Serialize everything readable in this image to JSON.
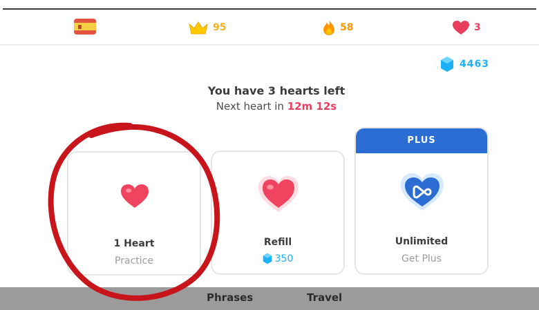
{
  "header": {
    "flag_icon": "spain-flag-icon",
    "crowns": {
      "icon": "crown-icon",
      "value": "95",
      "color": "#f2b01e"
    },
    "streak": {
      "icon": "flame-icon",
      "value": "58",
      "color": "#ff9600"
    },
    "hearts": {
      "icon": "heart-icon",
      "value": "3",
      "color": "#e83f5f"
    }
  },
  "gems": {
    "icon": "gem-icon",
    "value": "4463",
    "color": "#1cb0f6"
  },
  "message": {
    "title": "You have 3 hearts left",
    "next_prefix": "Next heart in",
    "timer": "12m 12s"
  },
  "cards": [
    {
      "title": "1 Heart",
      "subtitle": "Practice",
      "icon": "heart-icon"
    },
    {
      "title": "Refill",
      "price": "350",
      "icon": "heart-icon"
    },
    {
      "title": "Unlimited",
      "subtitle": "Get Plus",
      "badge": "PLUS",
      "icon": "infinity-heart-icon"
    }
  ],
  "bottom_tabs": [
    "Phrases",
    "Travel"
  ],
  "colors": {
    "plus_blue": "#2c6dd4",
    "heart_red": "#e83f5f",
    "annotation_red": "#c8151b"
  }
}
